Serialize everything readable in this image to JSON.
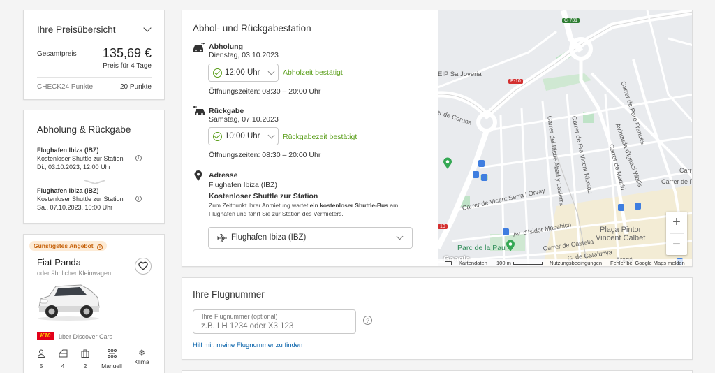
{
  "price": {
    "title": "Ihre Preisübersicht",
    "total_label": "Gesamtpreis",
    "total_value": "135,69 €",
    "days_note": "Preis für 4 Tage",
    "points_label": "CHECK24 Punkte",
    "points_value": "20 Punkte"
  },
  "pickup_return": {
    "title": "Abholung & Rückgabe",
    "pickup": {
      "location": "Flughafen Ibiza (IBZ)",
      "shuttle": "Kostenloser Shuttle zur Station",
      "datetime": "Di., 03.10.2023, 12:00 Uhr"
    },
    "return": {
      "location": "Flughafen Ibiza (IBZ)",
      "shuttle": "Kostenloser Shuttle zur Station",
      "datetime": "Sa., 07.10.2023, 10:00 Uhr"
    }
  },
  "car": {
    "badge": "Günstigstes Angebot",
    "name": "Fiat Panda",
    "subtitle": "oder ähnlicher Kleinwagen",
    "provider_logo": "K10",
    "provider": "über Discover Cars",
    "specs": [
      {
        "icon": "person-icon",
        "value": "5"
      },
      {
        "icon": "door-icon",
        "value": "4"
      },
      {
        "icon": "luggage-icon",
        "value": "2"
      },
      {
        "icon": "gearbox-icon",
        "value": "Manuell"
      },
      {
        "icon": "snowflake-icon",
        "value": "Klima"
      }
    ]
  },
  "station": {
    "title": "Abhol- und Rückgabestation",
    "pickup_label": "Abholung",
    "pickup_date": "Dienstag, 03.10.2023",
    "pickup_time": "12:00 Uhr",
    "pickup_confirm": "Abholzeit bestätigt",
    "pickup_hours": "Öffnungszeiten: 08:30 – 20:00 Uhr",
    "return_label": "Rückgabe",
    "return_date": "Samstag, 07.10.2023",
    "return_time": "10:00 Uhr",
    "return_confirm": "Rückgabezeit bestätigt",
    "return_hours": "Öffnungszeiten: 08:30 – 20:00 Uhr",
    "address_label": "Adresse",
    "address_value": "Flughafen Ibiza (IBZ)",
    "shuttle_title": "Kostenloser Shuttle zur Station",
    "shuttle_desc_1": "Zum Zeitpunkt Ihrer Anmietung wartet ",
    "shuttle_desc_bold": "ein kostenloser Shuttle-Bus",
    "shuttle_desc_2": " am",
    "shuttle_desc_3": "Flughafen und fährt Sie zur Station des Vermieters.",
    "airport_select": "Flughafen Ibiza (IBZ)"
  },
  "map": {
    "labels": {
      "road_c731": "C-731",
      "road_e10": "E-10",
      "road_10": "10",
      "eip": "EIP Sa Joveria",
      "corona": "er de Corona",
      "pere_frances": "Carrer de Pere Francès",
      "bisbe_abad": "Carrer del Bisbe Abad y Lasierra",
      "fra_vicent": "Carrer de Fra Vicent Nicolau",
      "madrid": "Carrer de Madrid",
      "ignasi": "Avinguda d'Ignasi Wallis",
      "vicent_serra": "Carrer de Vicent Serra i Orvay",
      "isidor": "Av. d'Isidor Macabich",
      "castella": "Carrer de Castella",
      "catalunya": "C/ de Catalunya",
      "arago": "Aragó",
      "placa": "Plaça Pintor",
      "placa2": "Vincent Calbet",
      "parc": "Parc de la Pau",
      "carrer_de": "Carrer de",
      "carrer_de_feli": "Carrer de Feli"
    },
    "footer": {
      "google": "Google",
      "data": "Kartendaten",
      "scale": "100 m",
      "terms": "Nutzungsbedingungen",
      "report": "Fehler bei Google Maps melden"
    },
    "zoom_in": "+",
    "zoom_out": "−"
  },
  "flight": {
    "title": "Ihre Flugnummer",
    "field_label": "Ihre Flugnummer (optional)",
    "placeholder": "z.B. LH 1234 oder X3 123",
    "help_link": "Hilf mir, meine Flugnummer zu finden"
  },
  "colors": {
    "accent_green": "#5a9e1a",
    "link_blue": "#005ea8",
    "badge_orange": "#c6620b",
    "k10_red": "#e2001a"
  }
}
